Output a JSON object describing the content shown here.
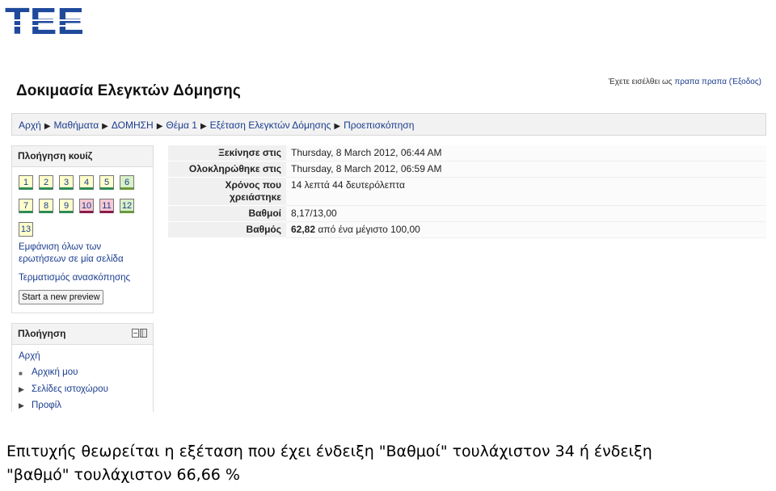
{
  "logo_text": "TEE",
  "moodle": {
    "site_title": "Δοκιμασία Ελεγκτών Δόμησης",
    "login": {
      "prefix": "Έχετε εισέλθει ως",
      "user": "πραπα πραπα",
      "logout": "(Έξοδος)"
    },
    "breadcrumb": [
      "Αρχή",
      "Μαθήματα",
      "ΔΟΜΗΣΗ",
      "Θέμα 1",
      "Εξέταση Ελεγκτών Δόμησης",
      "Προεπισκόπηση"
    ]
  },
  "quiz_nav": {
    "title": "Πλοήγηση κουίζ",
    "questions": [
      {
        "n": "1",
        "state": "correct"
      },
      {
        "n": "2",
        "state": "correct"
      },
      {
        "n": "3",
        "state": "correct"
      },
      {
        "n": "4",
        "state": "correct"
      },
      {
        "n": "5",
        "state": "correct"
      },
      {
        "n": "6",
        "state": "partial"
      },
      {
        "n": "7",
        "state": "correct"
      },
      {
        "n": "8",
        "state": "correct"
      },
      {
        "n": "9",
        "state": "correct"
      },
      {
        "n": "10",
        "state": "wrong"
      },
      {
        "n": "11",
        "state": "wrong"
      },
      {
        "n": "12",
        "state": "partial"
      },
      {
        "n": "13",
        "state": "none"
      }
    ],
    "show_all_line1": "Εμφάνιση όλων των",
    "show_all_line2": "ερωτήσεων σε μία σελίδα",
    "finish_review": "Τερματισμός ανασκόπησης",
    "start_preview": "Start a new preview"
  },
  "nav_block": {
    "title": "Πλοήγηση",
    "home": "Αρχή",
    "my_home": "Αρχική μου",
    "site_pages": "Σελίδες ιστοχώρου",
    "profile": "Προφίλ"
  },
  "summary": {
    "started_label": "Ξεκίνησε στις",
    "started_value": "Thursday, 8 March 2012, 06:44 AM",
    "completed_label": "Ολοκληρώθηκε στις",
    "completed_value": "Thursday, 8 March 2012, 06:59 AM",
    "time_label_1": "Χρόνος που",
    "time_label_2": "χρειάστηκε",
    "time_value": "14 λεπτά 44 δευτερόλεπτα",
    "marks_label": "Βαθμοί",
    "marks_value": "8,17/13,00",
    "grade_label": "Βαθμός",
    "grade_value": "62,82",
    "grade_suffix": "από ένα μέγιστο 100,00"
  },
  "caption": {
    "line1": "Επιτυχής θεωρείται η εξέταση που έχει ένδειξη \"Βαθμοί\" τουλάχιστον 34 ή ένδειξη",
    "line2": "\"βαθμό\" τουλάχιστον 66,66 %"
  },
  "colors": {
    "logo_blue": "#1f4a9c",
    "link_blue": "#1a3c8e",
    "correct": "#2e8b57",
    "wrong": "#8b1c4a",
    "partial": "#6a9b3a"
  }
}
